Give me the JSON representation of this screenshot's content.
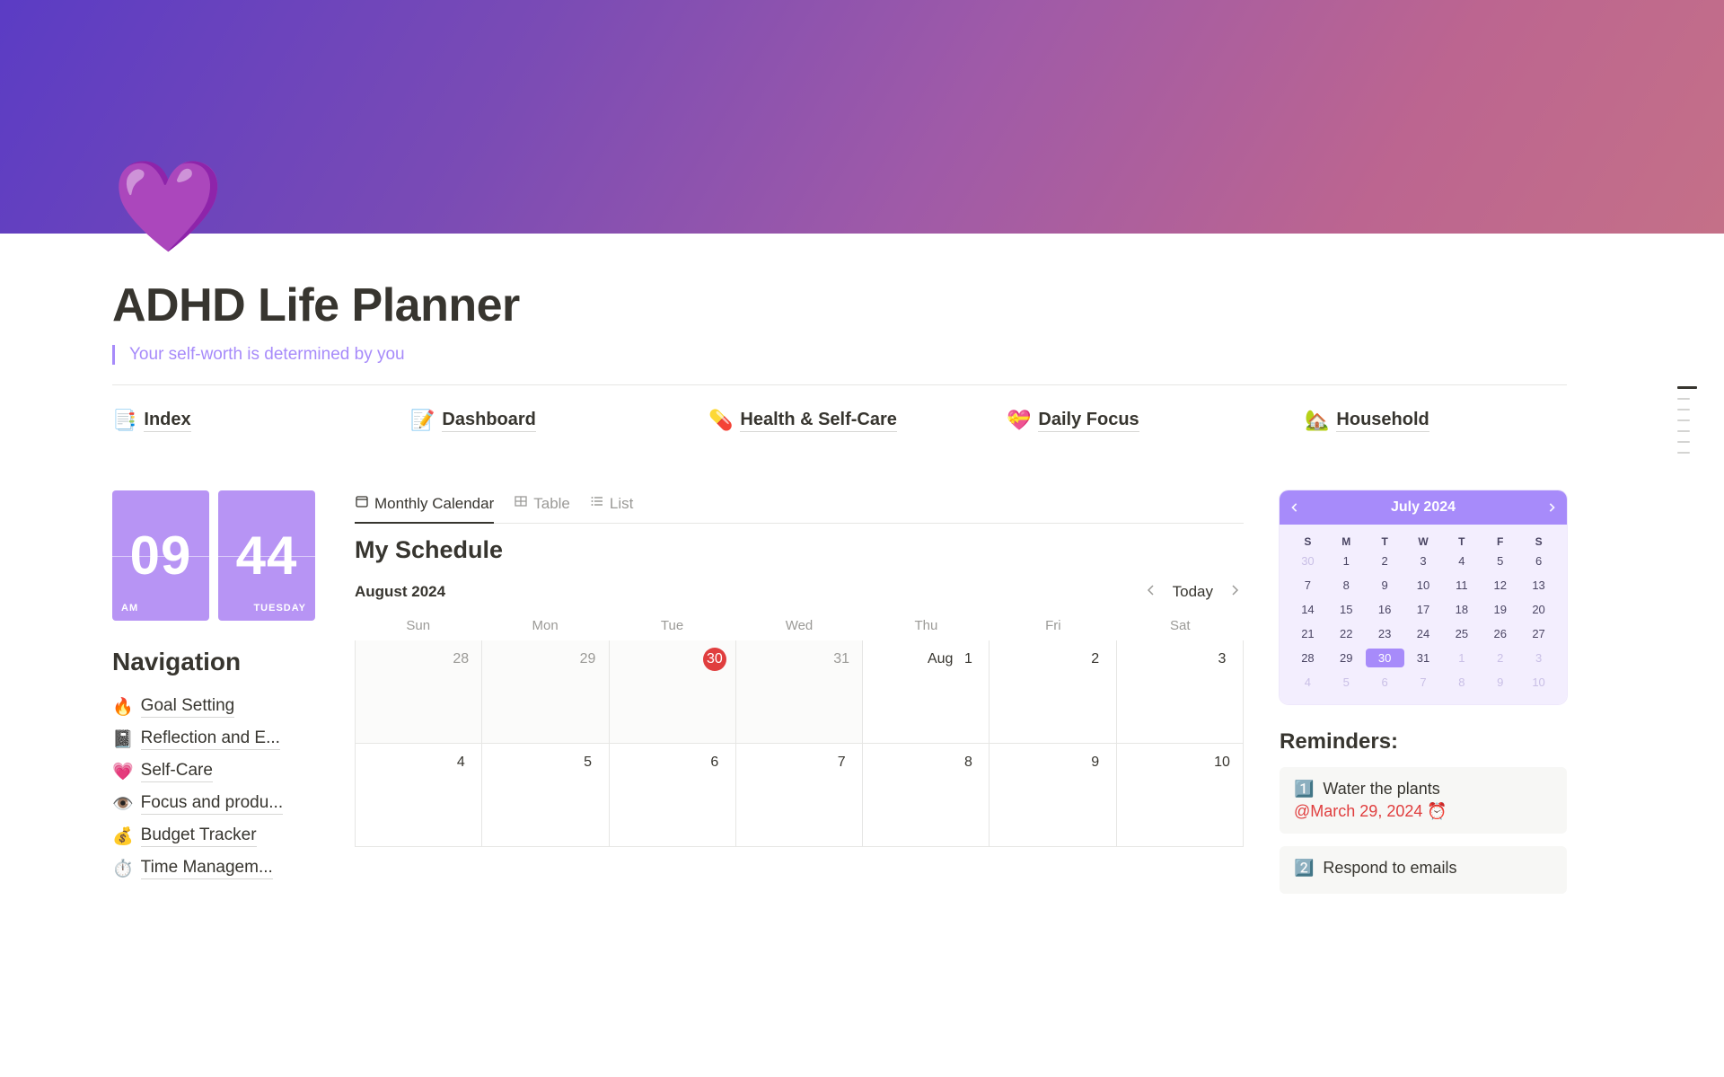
{
  "header": {
    "icon": "💜",
    "title": "ADHD Life Planner",
    "quote": "Your self-worth is determined by you"
  },
  "top_tabs": [
    {
      "emoji": "📑",
      "label": "Index"
    },
    {
      "emoji": "📝",
      "label": "Dashboard"
    },
    {
      "emoji": "💊",
      "label": "Health & Self-Care"
    },
    {
      "emoji": "💝",
      "label": "Daily Focus"
    },
    {
      "emoji": "🏡",
      "label": "Household"
    }
  ],
  "clock": {
    "hour": "09",
    "minute": "44",
    "ampm": "AM",
    "day": "TUESDAY"
  },
  "navigation": {
    "title": "Navigation",
    "items": [
      {
        "emoji": "🔥",
        "label": "Goal Setting"
      },
      {
        "emoji": "📓",
        "label": "Reflection and E..."
      },
      {
        "emoji": "💗",
        "label": "Self-Care"
      },
      {
        "emoji": "👁️",
        "label": "Focus and produ..."
      },
      {
        "emoji": "💰",
        "label": "Budget Tracker"
      },
      {
        "emoji": "⏱️",
        "label": "Time Managem..."
      }
    ]
  },
  "schedule": {
    "view_tabs": [
      {
        "label": "Monthly Calendar",
        "icon": "calendar",
        "active": true
      },
      {
        "label": "Table",
        "icon": "table",
        "active": false
      },
      {
        "label": "List",
        "icon": "list",
        "active": false
      }
    ],
    "title": "My Schedule",
    "month_label": "August 2024",
    "today_label": "Today",
    "dow": [
      "Sun",
      "Mon",
      "Tue",
      "Wed",
      "Thu",
      "Fri",
      "Sat"
    ],
    "cells": [
      {
        "num": "28",
        "out": true
      },
      {
        "num": "29",
        "out": true
      },
      {
        "num": "30",
        "out": true,
        "today": true
      },
      {
        "num": "31",
        "out": true
      },
      {
        "num": "1",
        "prefix": "Aug"
      },
      {
        "num": "2"
      },
      {
        "num": "3"
      },
      {
        "num": "4"
      },
      {
        "num": "5"
      },
      {
        "num": "6"
      },
      {
        "num": "7"
      },
      {
        "num": "8"
      },
      {
        "num": "9"
      },
      {
        "num": "10"
      }
    ]
  },
  "mini_calendar": {
    "title": "July 2024",
    "dow": [
      "S",
      "M",
      "T",
      "W",
      "T",
      "F",
      "S"
    ],
    "rows": [
      [
        {
          "n": "30",
          "out": true
        },
        {
          "n": "1"
        },
        {
          "n": "2"
        },
        {
          "n": "3"
        },
        {
          "n": "4"
        },
        {
          "n": "5"
        },
        {
          "n": "6"
        }
      ],
      [
        {
          "n": "7"
        },
        {
          "n": "8"
        },
        {
          "n": "9"
        },
        {
          "n": "10"
        },
        {
          "n": "11"
        },
        {
          "n": "12"
        },
        {
          "n": "13"
        }
      ],
      [
        {
          "n": "14"
        },
        {
          "n": "15"
        },
        {
          "n": "16"
        },
        {
          "n": "17"
        },
        {
          "n": "18"
        },
        {
          "n": "19"
        },
        {
          "n": "20"
        }
      ],
      [
        {
          "n": "21"
        },
        {
          "n": "22"
        },
        {
          "n": "23"
        },
        {
          "n": "24"
        },
        {
          "n": "25"
        },
        {
          "n": "26"
        },
        {
          "n": "27"
        }
      ],
      [
        {
          "n": "28"
        },
        {
          "n": "29"
        },
        {
          "n": "30",
          "sel": true
        },
        {
          "n": "31"
        },
        {
          "n": "1",
          "out": true
        },
        {
          "n": "2",
          "out": true
        },
        {
          "n": "3",
          "out": true
        }
      ],
      [
        {
          "n": "4",
          "out": true
        },
        {
          "n": "5",
          "out": true
        },
        {
          "n": "6",
          "out": true
        },
        {
          "n": "7",
          "out": true
        },
        {
          "n": "8",
          "out": true
        },
        {
          "n": "9",
          "out": true
        },
        {
          "n": "10",
          "out": true
        }
      ]
    ]
  },
  "reminders": {
    "title": "Reminders:",
    "items": [
      {
        "emoji": "1️⃣",
        "text": "Water the plants",
        "date": "March 29, 2024",
        "alarm": "⏰"
      },
      {
        "emoji": "2️⃣",
        "text": "Respond to emails",
        "date": "",
        "alarm": ""
      }
    ]
  }
}
